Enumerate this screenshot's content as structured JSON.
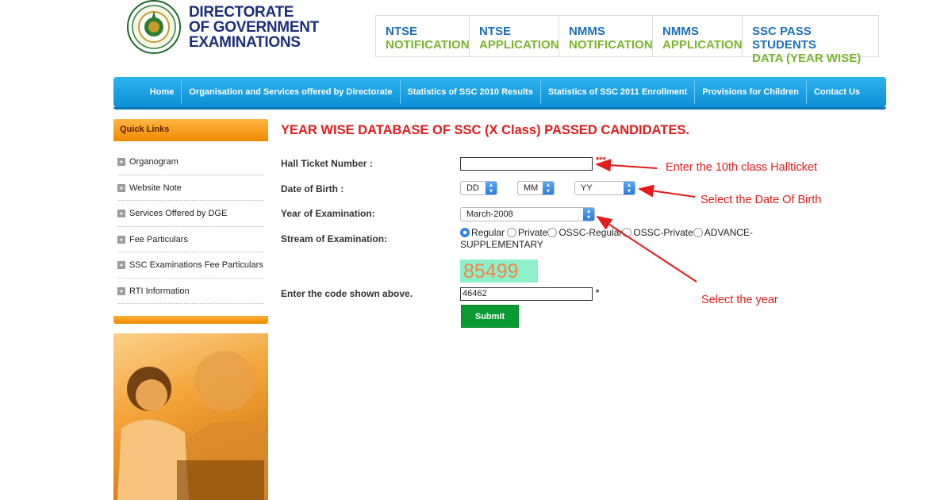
{
  "header": {
    "logo_line1": "DIRECTORATE",
    "logo_line2": "OF GOVERNMENT",
    "logo_line3": "EXAMINATIONS",
    "top_links": [
      {
        "line1": "NTSE",
        "line2": "NOTIFICATION"
      },
      {
        "line1": "NTSE",
        "line2": "APPLICATION"
      },
      {
        "line1": "NMMS",
        "line2": "NOTIFICATION"
      },
      {
        "line1": "NMMS",
        "line2": "APPLICATION"
      },
      {
        "line1": "SSC PASS STUDENTS",
        "line2": "DATA (YEAR WISE)"
      }
    ]
  },
  "nav": [
    "Home",
    "Organisation and Services offered by Directorate",
    "Statistics of SSC 2010 Results",
    "Statistics of SSC 2011 Enrollment",
    "Provisions for Children",
    "Contact Us"
  ],
  "sidebar": {
    "heading": "Quick Links",
    "items": [
      "Organogram",
      "Website Note",
      "Services Offered by DGE",
      "Fee Particulars",
      "SSC Examinations Fee Particulars",
      "RTI Information"
    ]
  },
  "form": {
    "title": "YEAR WISE DATABASE OF SSC (X Class) PASSED CANDIDATES.",
    "hall_ticket_label": "Hall Ticket Number :",
    "hall_ticket_value": "",
    "required_mark": "***",
    "dob_label": "Date of Birth :",
    "dob_day": "DD",
    "dob_month": "MM",
    "dob_year": "YY",
    "year_label": "Year of Examination:",
    "year_value": "March-2008",
    "stream_label": "Stream of Examination:",
    "stream_options": [
      "Regular",
      "Private",
      "OSSC-Regular",
      "OSSC-Private",
      "ADVANCE-SUPPLEMENTARY"
    ],
    "stream_selected": "Regular",
    "captcha": "85499",
    "code_label": "Enter the code shown above.",
    "code_value": "46462",
    "code_required": "*",
    "submit_label": "Submit"
  },
  "annotations": {
    "hall": "Enter the 10th class Hallticket",
    "dob": "Select the Date Of Birth",
    "year": "Select the year"
  },
  "colors": {
    "title_red": "#e31b1b",
    "nav_blue": "#0c8fd6",
    "quick_orange": "#f08a00",
    "submit_green": "#0a9a34",
    "link_blue": "#1e6fb8",
    "link_green": "#79b52c"
  }
}
